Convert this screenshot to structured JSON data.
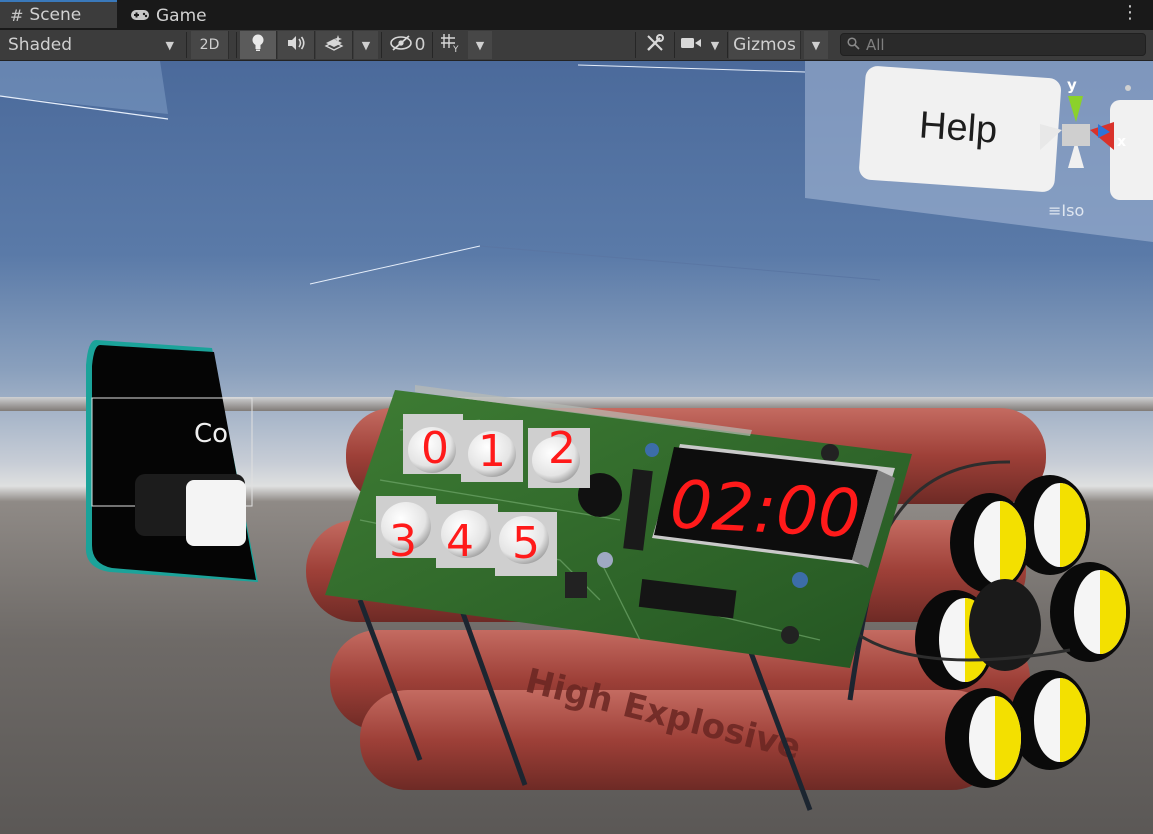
{
  "tabs": [
    {
      "label": "Scene",
      "icon": "grid-hash-icon"
    },
    {
      "label": "Game",
      "icon": "gamepad-icon"
    }
  ],
  "toolbar": {
    "shading_mode": "Shaded",
    "toggle_2d": "2D",
    "hidden_count": "0",
    "gizmos_label": "Gizmos",
    "search_placeholder": "All"
  },
  "scene": {
    "help_button_label": "Help",
    "partial_text": "Co",
    "keypad_digits": [
      "0",
      "1",
      "2",
      "3",
      "4",
      "5"
    ],
    "timer_display": "02:00",
    "dynamite_text": "High Explosive",
    "gizmo_axis_y": "y",
    "gizmo_axis_x": "x",
    "projection_label": "Iso"
  },
  "colors": {
    "accent_tab": "#3a79bb",
    "digit_red": "#ff1a1a",
    "pcb_green": "#2f6b2a",
    "dynamite_red": "#a8473f"
  }
}
